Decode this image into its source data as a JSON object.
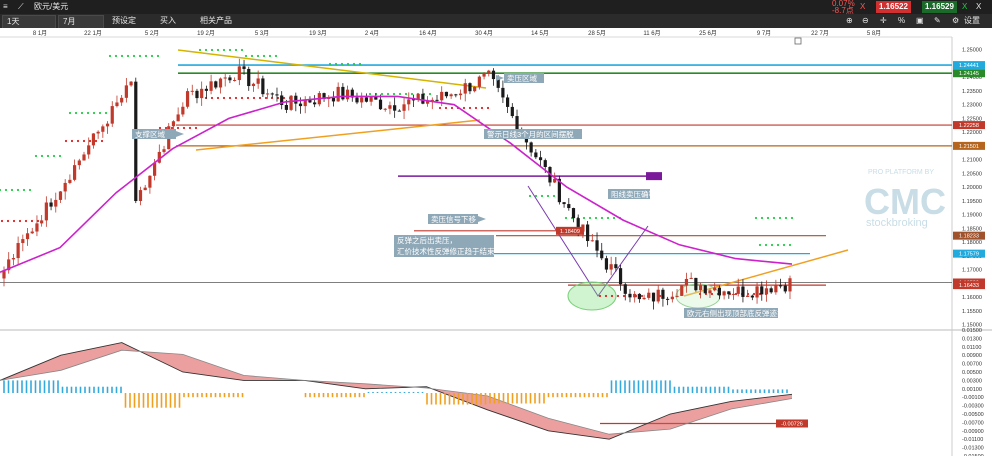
{
  "app": {
    "symbol": "欧元/美元",
    "bid": "1.16522",
    "ask": "1.16529",
    "change": "0.07%",
    "change_points": "-8.7点",
    "settings_label": "设置",
    "close_label": "X",
    "pct_label": "%"
  },
  "toolbar": {
    "timeframe": "1天",
    "period": "7月",
    "preset": "预设定",
    "buy": "买入",
    "related": "相关产品"
  },
  "date_axis": [
    "8 1月",
    "22 1月",
    "5 2月",
    "19 2月",
    "5 3月",
    "19 3月",
    "2 4月",
    "16 4月",
    "30 4月",
    "14 5月",
    "28 5月",
    "11 6月",
    "25 6月",
    "9 7月",
    "22 7月",
    "5 8月"
  ],
  "price_axis": [
    "1.25000",
    "1.24500",
    "1.24000",
    "1.23500",
    "1.23000",
    "1.22500",
    "1.22000",
    "1.21500",
    "1.21000",
    "1.20500",
    "1.20000",
    "1.19500",
    "1.19000",
    "1.18500",
    "1.18000",
    "1.17500",
    "1.17000",
    "1.16500",
    "1.16000",
    "1.15500",
    "1.15000"
  ],
  "macd_axis": [
    "0.01500",
    "0.01300",
    "0.01100",
    "0.00900",
    "0.00700",
    "0.00500",
    "0.00300",
    "0.00100",
    "-0.00100",
    "-0.00300",
    "-0.00500",
    "-0.00700",
    "-0.00900",
    "-0.01100",
    "-0.01300",
    "-0.01500"
  ],
  "price_tags": [
    {
      "text": "1.24441",
      "bg": "#22aadd"
    },
    {
      "text": "1.24145",
      "bg": "#2a8a2a"
    },
    {
      "text": "1.22258",
      "bg": "#c0392b"
    },
    {
      "text": "1.21501",
      "bg": "#b5651d"
    },
    {
      "text": "1.18233",
      "bg": "#a0522d"
    },
    {
      "text": "1.17579",
      "bg": "#22aadd"
    },
    {
      "text": "1.16529",
      "bg": "#c0392b"
    },
    {
      "text": "1.16433",
      "bg": "#c0392b"
    }
  ],
  "inline_tags": [
    {
      "text": "1.18409",
      "bg": "#c0392b"
    },
    {
      "text": "-0.00726",
      "bg": "#c0392b"
    }
  ],
  "annotations": [
    "卖压区域",
    "支撑区域",
    "警示日线3个月的区间摆脱",
    "阻线卖压确等",
    "卖压信号下移",
    "反弹之后出卖压，",
    "汇价技术性反弹修正趋于结束",
    "欧元右侧出现顶部底反弹迹象"
  ],
  "watermark": {
    "line1": "PRO PLATFORM BY",
    "line2": "CMC",
    "line3": "stockbroking"
  },
  "colors": {
    "bull": "#c0392b",
    "bear": "#1a1a1a",
    "ma": "#cc22cc",
    "dots_green": "#22cc44",
    "dots_red": "#dd2222",
    "cyan": "#22aadd",
    "macd_pos": "#33aadd",
    "macd_neg": "#f0a020"
  },
  "chart_data": {
    "type": "candlestick",
    "x": [
      "8 1月",
      "22 1月",
      "5 2月",
      "19 2月",
      "5 3月",
      "19 3月",
      "2 4月",
      "16 4月",
      "30 4月",
      "14 5月",
      "28 5月",
      "11 6月",
      "25 6月",
      "9 7月"
    ],
    "close": [
      1.195,
      1.233,
      1.242,
      1.23,
      1.234,
      1.23,
      1.232,
      1.24,
      1.21,
      1.18,
      1.158,
      1.165,
      1.162,
      1.1653
    ],
    "moving_average": [
      1.178,
      1.198,
      1.214,
      1.225,
      1.231,
      1.233,
      1.233,
      1.23,
      1.216,
      1.2,
      1.188,
      1.179,
      1.174,
      1.172
    ],
    "horizontal_levels": [
      1.24441,
      1.24145,
      1.22258,
      1.21501,
      1.18409,
      1.18233,
      1.17579,
      1.16433
    ],
    "macd": [
      0.003,
      0.009,
      0.012,
      0.005,
      0.003,
      0.003,
      0.001,
      0.0015,
      -0.004,
      -0.009,
      -0.011,
      -0.005,
      -0.002,
      -0.0003
    ],
    "ylim": [
      1.148,
      1.255
    ],
    "macd_ylim": [
      -0.015,
      0.015
    ]
  }
}
